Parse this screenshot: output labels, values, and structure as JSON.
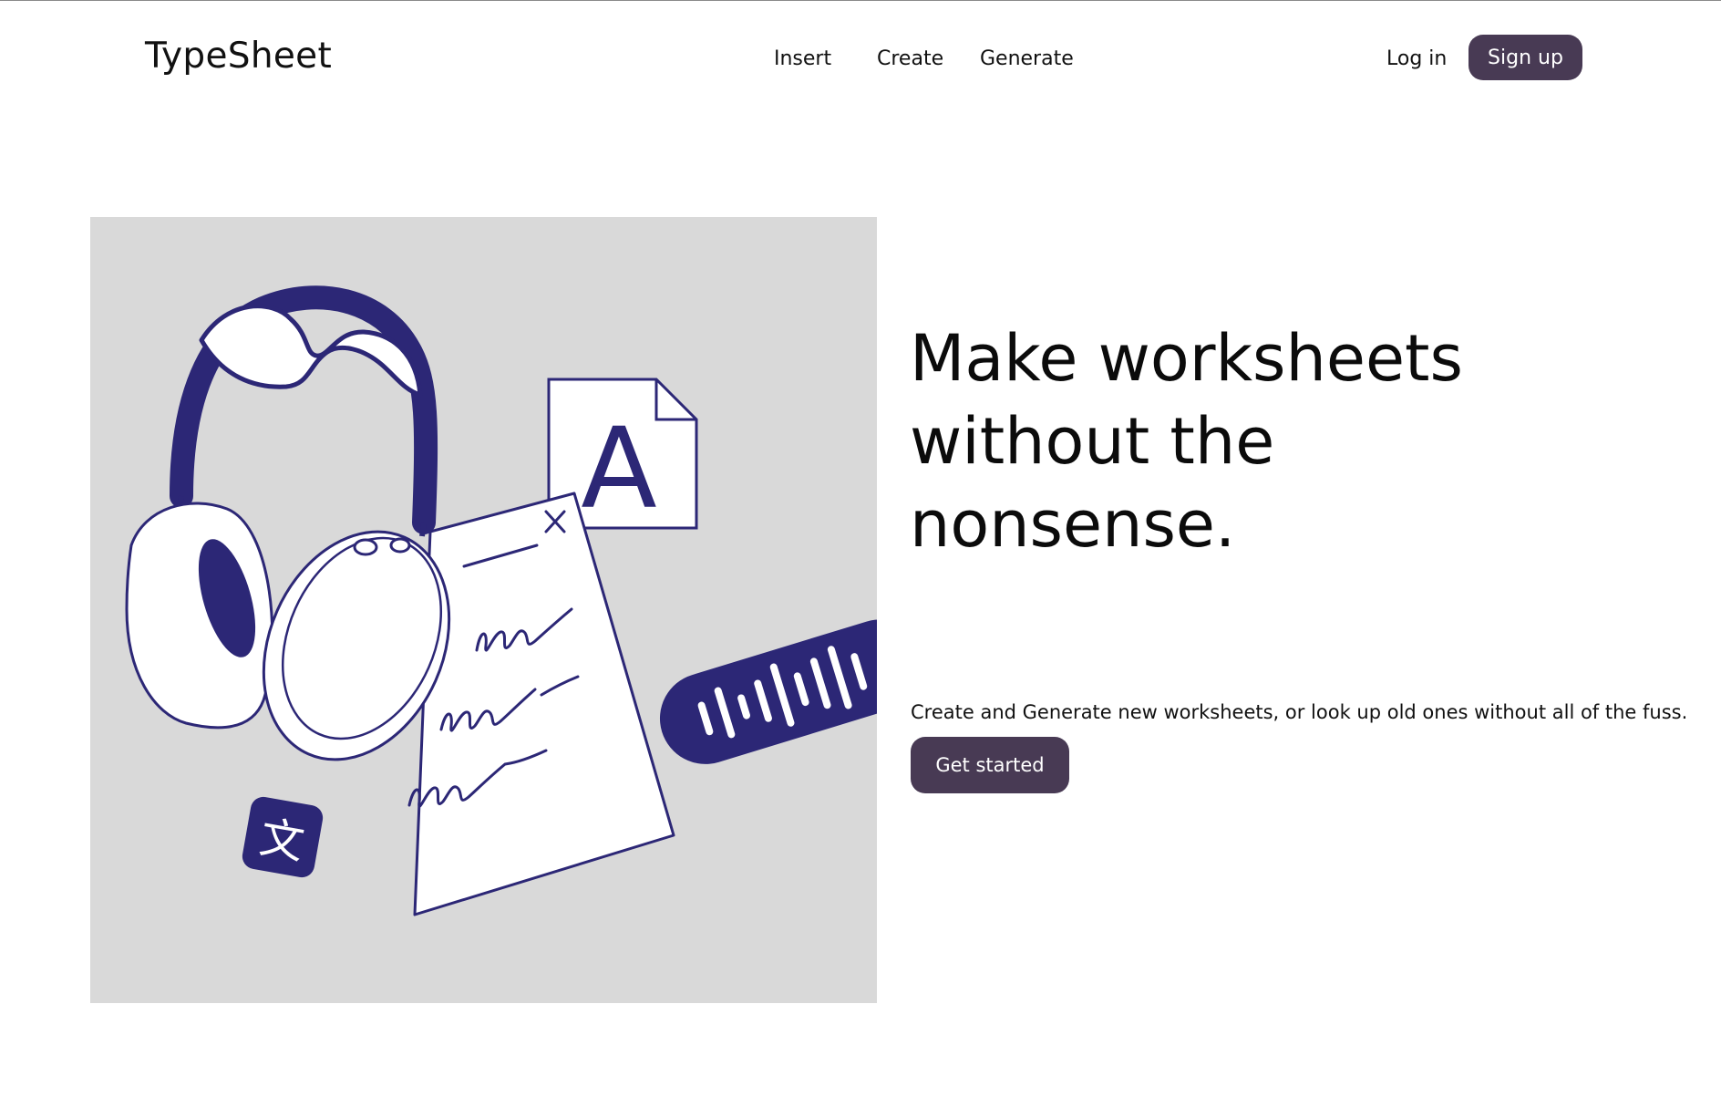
{
  "header": {
    "logo": "TypeSheet",
    "nav": [
      {
        "label": "Insert"
      },
      {
        "label": "Create"
      },
      {
        "label": "Generate"
      }
    ],
    "login_label": "Log in",
    "signup_label": "Sign up"
  },
  "hero": {
    "headline_lines": [
      "Make worksheets",
      "without the",
      "nonsense."
    ],
    "subtext": "Create and Generate new worksheets, or look up old ones without all of the fuss.",
    "cta_label": "Get started",
    "illustration": {
      "letter_tile": "A",
      "translate_glyph": "文",
      "icons": [
        "headphones-icon",
        "document-icon",
        "font-file-icon",
        "translate-icon",
        "audio-waveform-icon"
      ]
    }
  },
  "colors": {
    "accent": "#483a54",
    "illustration_ink": "#2c2776",
    "illustration_bg": "#d9d9d9",
    "page_bg": "#ffffff"
  }
}
